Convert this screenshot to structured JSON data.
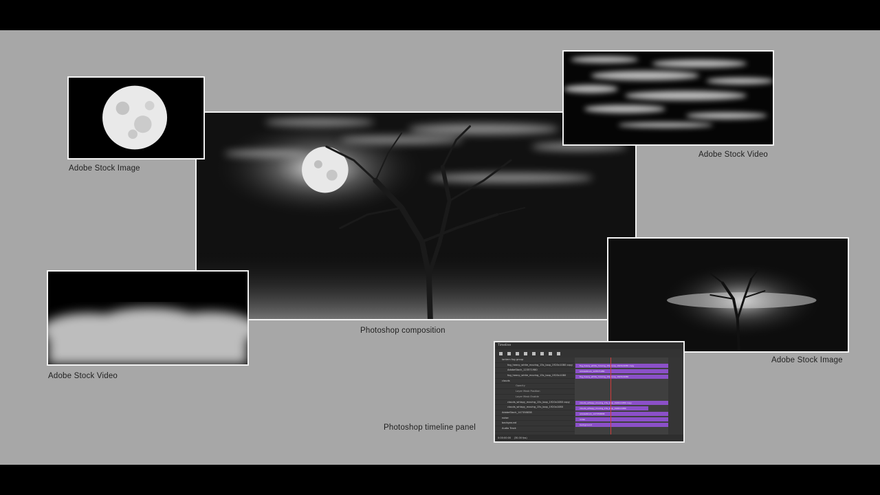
{
  "captions": {
    "top_left": "Adobe Stock Image",
    "top_right": "Adobe Stock Video",
    "center": "Photoshop composition",
    "bottom_left": "Adobe Stock Video",
    "bottom_right": "Adobe Stock Image",
    "timeline": "Photoshop timeline panel"
  },
  "timeline": {
    "title": "Timeline",
    "rows": [
      {
        "label": "lantern fog group",
        "type": "group"
      },
      {
        "label": "fog_heavy_white_moving_15s_loop_1920x1080 copy",
        "type": "layer"
      },
      {
        "label": "AdobeStock_123571980",
        "type": "layer"
      },
      {
        "label": "fog_heavy_white_moving_15s_loop_1920x1080",
        "type": "layer"
      },
      {
        "label": "clouds",
        "type": "group"
      },
      {
        "label": "Opacity",
        "type": "prop"
      },
      {
        "label": "Layer Mask Position",
        "type": "prop"
      },
      {
        "label": "Layer Mask Enable",
        "type": "prop"
      },
      {
        "label": "clouds_whispy_moving_15s_loop_1920x1080 copy",
        "type": "layer"
      },
      {
        "label": "clouds_whispy_moving_15s_loop_1920x1080",
        "type": "layer"
      },
      {
        "label": "AdobeStock_147358838",
        "type": "layer"
      },
      {
        "label": "noise",
        "type": "layer"
      },
      {
        "label": "background",
        "type": "layer"
      },
      {
        "label": "Audio Track",
        "type": "audio"
      }
    ],
    "tracks": [
      {
        "label": "fog_heavy_white_moving_15s_loop_1920x1080 copy"
      },
      {
        "label": "AdobeStock_123571980"
      },
      {
        "label": "fog_heavy_white_moving_15s_loop_1920x1080"
      },
      {
        "label": "clouds_whispy_moving_15s_loop_1920x1080 copy"
      },
      {
        "label": "clouds_whispy_moving_15s_loop_1920x1080"
      },
      {
        "label": "AdobeStock_147358838"
      },
      {
        "label": "noise"
      },
      {
        "label": "background"
      }
    ],
    "timecode": "0:00:00:00",
    "fps": "(30.00 fps)"
  },
  "colors": {
    "stage_bg": "#a7a7a7",
    "track_purple": "#8b50c8",
    "playhead": "#d23b3b"
  }
}
